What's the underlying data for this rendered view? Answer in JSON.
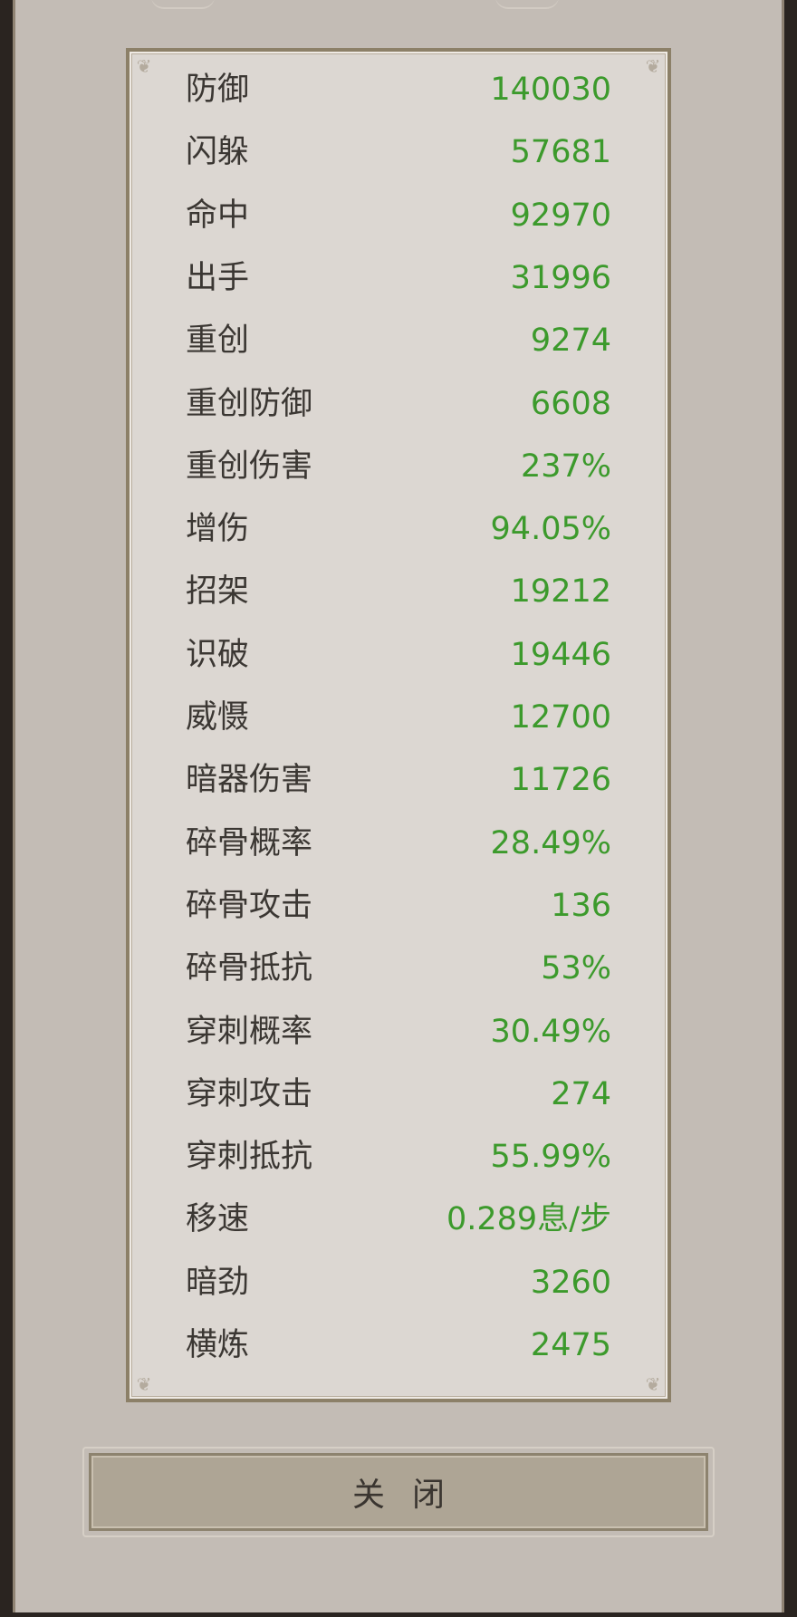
{
  "stats": [
    {
      "label": "防御",
      "value": "140030"
    },
    {
      "label": "闪躲",
      "value": "57681"
    },
    {
      "label": "命中",
      "value": "92970"
    },
    {
      "label": "出手",
      "value": "31996"
    },
    {
      "label": "重创",
      "value": "9274"
    },
    {
      "label": "重创防御",
      "value": "6608"
    },
    {
      "label": "重创伤害",
      "value": "237%"
    },
    {
      "label": "增伤",
      "value": "94.05%"
    },
    {
      "label": "招架",
      "value": "19212"
    },
    {
      "label": "识破",
      "value": "19446"
    },
    {
      "label": "威慑",
      "value": "12700"
    },
    {
      "label": "暗器伤害",
      "value": "11726"
    },
    {
      "label": "碎骨概率",
      "value": "28.49%"
    },
    {
      "label": "碎骨攻击",
      "value": "136"
    },
    {
      "label": "碎骨抵抗",
      "value": "53%"
    },
    {
      "label": "穿刺概率",
      "value": "30.49%"
    },
    {
      "label": "穿刺攻击",
      "value": "274"
    },
    {
      "label": "穿刺抵抗",
      "value": "55.99%"
    },
    {
      "label": "移速",
      "value": "0.289息/步"
    },
    {
      "label": "暗劲",
      "value": "3260"
    },
    {
      "label": "横炼",
      "value": "2475"
    }
  ],
  "close_button": {
    "label": "关闭"
  },
  "colors": {
    "label": "#3b3733",
    "value": "#3c9a2c",
    "panel": "#dcd7d2",
    "frame": "#8c8068"
  },
  "icons": [
    "corner-ornament-icon"
  ]
}
